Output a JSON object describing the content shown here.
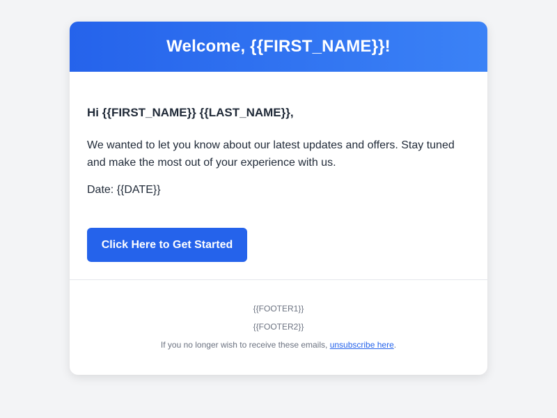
{
  "header": {
    "title": "Welcome, {{FIRST_NAME}}!"
  },
  "content": {
    "greeting": "Hi {{FIRST_NAME}} {{LAST_NAME}},",
    "message": "We wanted to let you know about our latest updates and offers. Stay tuned and make the most out of your experience with us.",
    "date": "Date: {{DATE}}",
    "cta_label": "Click Here to Get Started"
  },
  "footer": {
    "line1": "{{FOOTER1}}",
    "line2": "{{FOOTER2}}",
    "unsubscribe_prefix": "If you no longer wish to receive these emails, ",
    "unsubscribe_link": "unsubscribe here",
    "unsubscribe_suffix": "."
  },
  "colors": {
    "page_background": "#f3f4f6",
    "header_gradient_start": "#2563eb",
    "header_gradient_end": "#3b82f6",
    "button": "#2563eb",
    "text": "#1f2937",
    "footer_text": "#6b7280",
    "link": "#2563eb"
  }
}
